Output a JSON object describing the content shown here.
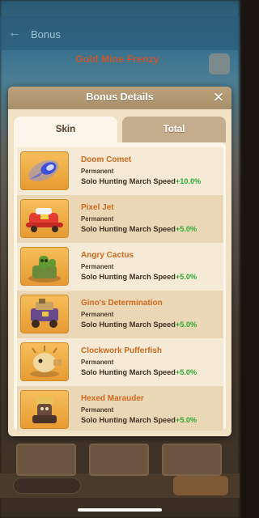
{
  "background": {
    "screen_title": "Bonus",
    "event_banner": "Gold Mine Frenzy"
  },
  "modal": {
    "title": "Bonus Details",
    "close_icon": "close-icon",
    "tabs": [
      {
        "label": "Skin",
        "active": true
      },
      {
        "label": "Total",
        "active": false
      }
    ],
    "items": [
      {
        "name": "Doom Comet",
        "duration": "Permanent",
        "effect": "Solo Hunting March Speed",
        "value": "+10.0%",
        "icon": "comet-icon"
      },
      {
        "name": "Pixel Jet",
        "duration": "Permanent",
        "effect": "Solo Hunting March Speed",
        "value": "+5.0%",
        "icon": "jet-icon"
      },
      {
        "name": "Angry Cactus",
        "duration": "Permanent",
        "effect": "Solo Hunting March Speed",
        "value": "+5.0%",
        "icon": "cactus-icon"
      },
      {
        "name": "Gino's Determination",
        "duration": "Permanent",
        "effect": "Solo Hunting March Speed",
        "value": "+5.0%",
        "icon": "cart-icon"
      },
      {
        "name": "Clockwork Pufferfish",
        "duration": "Permanent",
        "effect": "Solo Hunting March Speed",
        "value": "+5.0%",
        "icon": "pufferfish-icon"
      },
      {
        "name": "Hexed Marauder",
        "duration": "Permanent",
        "effect": "Solo Hunting March Speed",
        "value": "+5.0%",
        "icon": "marauder-icon"
      }
    ]
  },
  "colors": {
    "item_name": "#d0691e",
    "bonus_value": "#2faa34",
    "header": "#a8906a",
    "thumb_bg": "#e79b32"
  }
}
